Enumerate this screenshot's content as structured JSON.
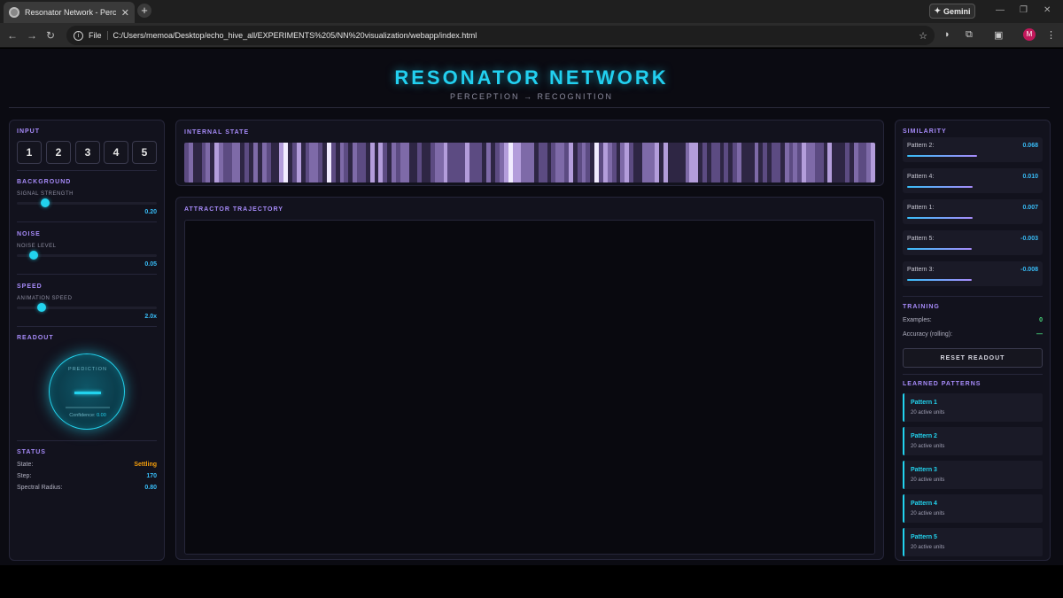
{
  "browser": {
    "tab_title": "Resonator Network - Perceptio",
    "tab_close": "✕",
    "new_tab": "+",
    "gemini_label": "Gemini",
    "gemini_glyph": "✦",
    "minimize": "—",
    "restore": "❐",
    "close": "✕",
    "back": "←",
    "forward": "→",
    "reload": "↻",
    "info_glyph": "i",
    "file_label": "File",
    "url": "C:/Users/memoa/Desktop/echo_hive_all/EXPERIMENTS%205/NN%20visualization/webapp/index.html",
    "star": "☆",
    "avatar_initial": "M",
    "menu_glyph": "⋮"
  },
  "header": {
    "title": "RESONATOR NETWORK",
    "subtitle": "PERCEPTION → RECOGNITION"
  },
  "input": {
    "title": "INPUT",
    "buttons": [
      "1",
      "2",
      "3",
      "4",
      "5"
    ]
  },
  "background": {
    "title": "BACKGROUND",
    "label": "SIGNAL STRENGTH",
    "value": "0.20",
    "level": 0.2
  },
  "noise": {
    "title": "NOISE",
    "label": "NOISE LEVEL",
    "value": "0.05",
    "level": 0.12
  },
  "speed": {
    "title": "SPEED",
    "label": "ANIMATION SPEED",
    "value": "2.0x",
    "level": 0.18
  },
  "readout": {
    "title": "READOUT",
    "orb_label": "PREDICTION",
    "confidence_label": "Confidence:",
    "confidence_value": "0.00"
  },
  "status": {
    "title": "STATUS",
    "rows": [
      {
        "label": "State:",
        "value": "Settling",
        "color": "#f59e0b"
      },
      {
        "label": "Step:",
        "value": "170",
        "color": "#38bdf8"
      },
      {
        "label": "Spectral Radius:",
        "value": "0.80",
        "color": "#38bdf8"
      }
    ]
  },
  "internal_state": {
    "title": "INTERNAL STATE"
  },
  "trajectory": {
    "title": "ATTRACTOR TRAJECTORY"
  },
  "similarity": {
    "title": "SIMILARITY",
    "items": [
      {
        "name": "Pattern 2:",
        "value": "0.068",
        "fill": 0.5
      },
      {
        "name": "Pattern 4:",
        "value": "0.010",
        "fill": 0.47
      },
      {
        "name": "Pattern 1:",
        "value": "0.007",
        "fill": 0.47
      },
      {
        "name": "Pattern 5:",
        "value": "-0.003",
        "fill": 0.46
      },
      {
        "name": "Pattern 3:",
        "value": "-0.008",
        "fill": 0.46
      }
    ]
  },
  "training": {
    "title": "TRAINING",
    "examples_label": "Examples:",
    "examples_value": "0",
    "accuracy_label": "Accuracy (rolling):",
    "accuracy_value": "—",
    "reset_label": "RESET READOUT"
  },
  "learned": {
    "title": "LEARNED PATTERNS",
    "items": [
      {
        "name": "Pattern 1",
        "sub": "20 active units"
      },
      {
        "name": "Pattern 2",
        "sub": "20 active units"
      },
      {
        "name": "Pattern 3",
        "sub": "20 active units"
      },
      {
        "name": "Pattern 4",
        "sub": "20 active units"
      },
      {
        "name": "Pattern 5",
        "sub": "20 active units"
      }
    ]
  },
  "colors": {
    "accent": "#22d3ee",
    "section": "#a78bfa",
    "value": "#38bdf8",
    "warning": "#f59e0b",
    "success": "#4ade80"
  }
}
